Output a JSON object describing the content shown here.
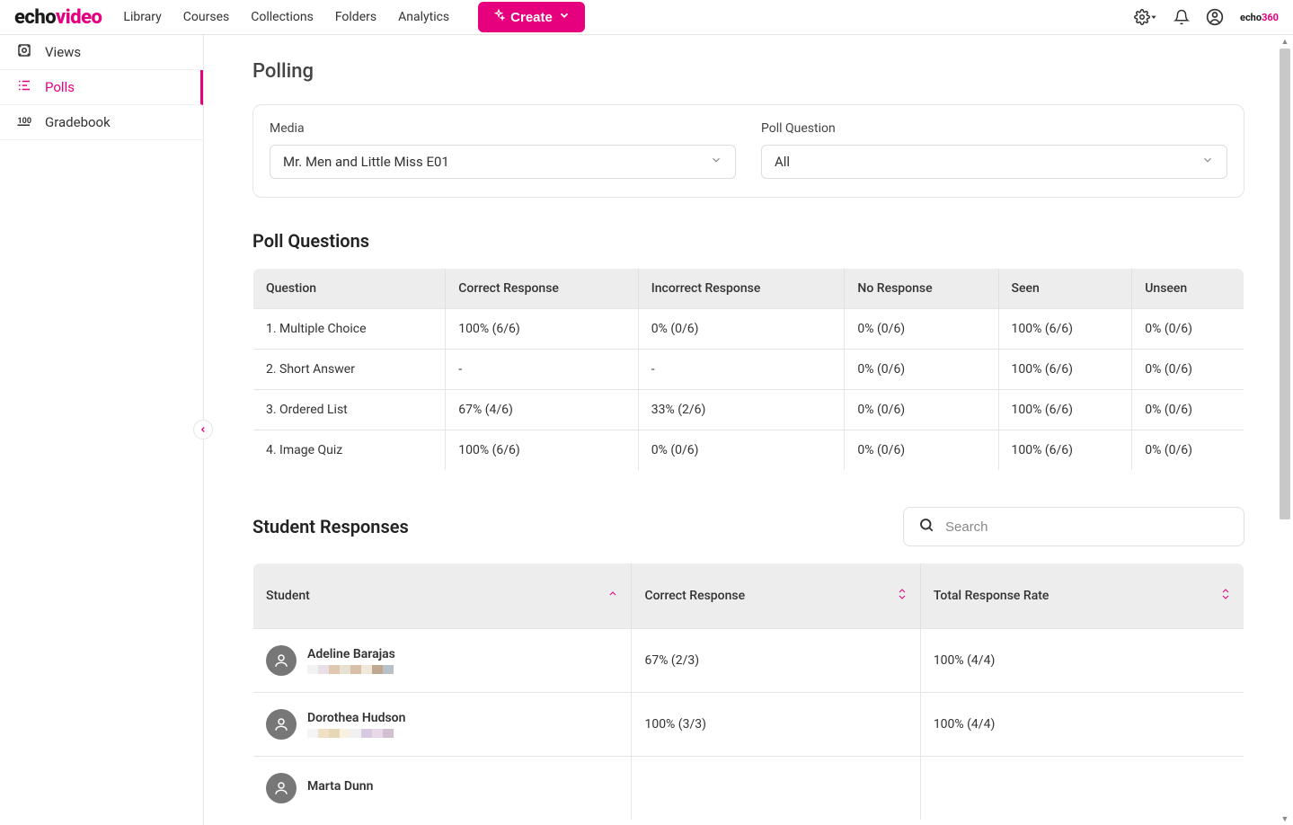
{
  "logo": {
    "part1": "echo",
    "part2": "video"
  },
  "topnav": {
    "library": "Library",
    "courses": "Courses",
    "collections": "Collections",
    "folders": "Folders",
    "analytics": "Analytics",
    "create": "Create"
  },
  "brandmark": {
    "part1": "echo",
    "part2": "360"
  },
  "sidebar": {
    "views": "Views",
    "polls": "Polls",
    "gradebook": "Gradebook"
  },
  "page": {
    "title": "Polling",
    "media_label": "Media",
    "media_value": "Mr. Men and Little Miss E01",
    "question_label": "Poll Question",
    "question_value": "All"
  },
  "poll_questions": {
    "heading": "Poll Questions",
    "headers": {
      "question": "Question",
      "correct": "Correct Response",
      "incorrect": "Incorrect Response",
      "noresp": "No Response",
      "seen": "Seen",
      "unseen": "Unseen"
    },
    "rows": [
      {
        "question": "1. Multiple Choice",
        "correct": "100% (6/6)",
        "incorrect": "0% (0/6)",
        "noresp": "0% (0/6)",
        "seen": "100% (6/6)",
        "unseen": "0% (0/6)"
      },
      {
        "question": "2. Short Answer",
        "correct": "-",
        "incorrect": "-",
        "noresp": "0% (0/6)",
        "seen": "100% (6/6)",
        "unseen": "0% (0/6)"
      },
      {
        "question": "3. Ordered List",
        "correct": "67% (4/6)",
        "incorrect": "33% (2/6)",
        "noresp": "0% (0/6)",
        "seen": "100% (6/6)",
        "unseen": "0% (0/6)"
      },
      {
        "question": "4. Image Quiz",
        "correct": "100% (6/6)",
        "incorrect": "0% (0/6)",
        "noresp": "0% (0/6)",
        "seen": "100% (6/6)",
        "unseen": "0% (0/6)"
      }
    ]
  },
  "student_responses": {
    "heading": "Student Responses",
    "search_placeholder": "Search",
    "headers": {
      "student": "Student",
      "correct": "Correct Response",
      "total": "Total Response Rate"
    },
    "rows": [
      {
        "name": "Adeline Barajas",
        "correct": "67% (2/3)",
        "total": "100% (4/4)",
        "colors": [
          "#f2f2f2",
          "#e8dfe8",
          "#e0c8b0",
          "#e8e0d0",
          "#d8c0a8",
          "#f0e8d8",
          "#c0a890",
          "#b8c0c8"
        ]
      },
      {
        "name": "Dorothea Hudson",
        "correct": "100% (3/3)",
        "total": "100% (4/4)",
        "colors": [
          "#f5f5f5",
          "#f0e0c8",
          "#e8d8b8",
          "#f8f0e0",
          "#f0f0f0",
          "#d8c8e0",
          "#e8d8e8",
          "#d0c0d0"
        ]
      },
      {
        "name": "Marta Dunn",
        "correct": "",
        "total": "",
        "colors": []
      }
    ]
  }
}
